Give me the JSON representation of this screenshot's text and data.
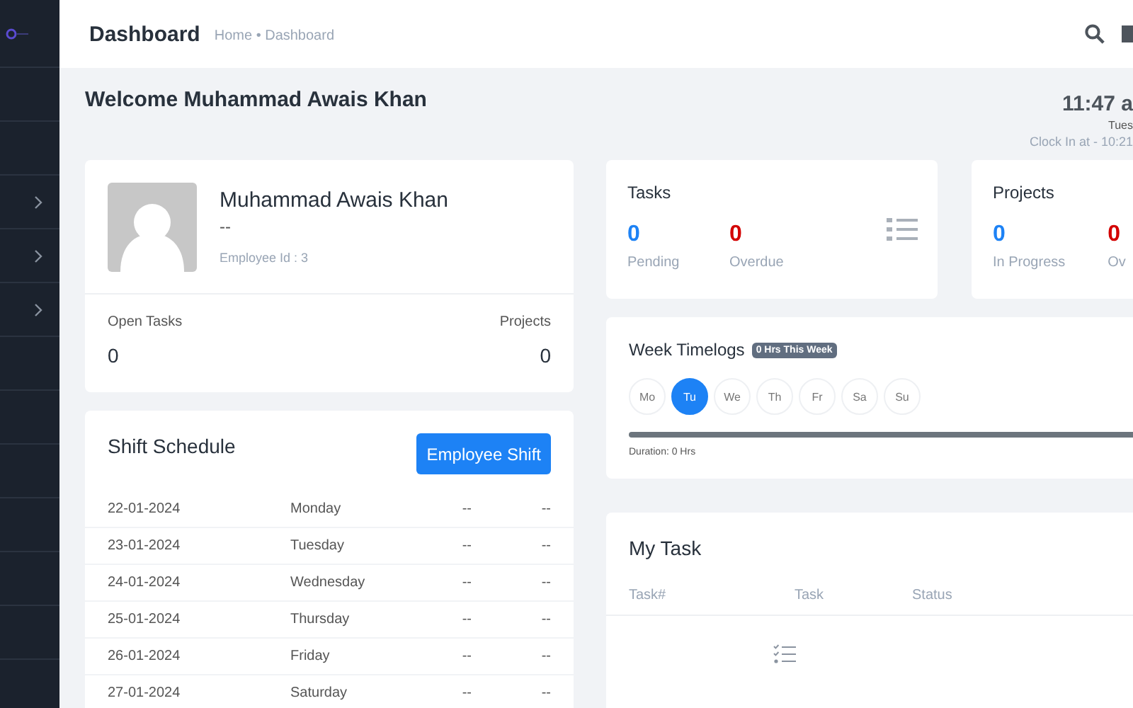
{
  "header": {
    "title": "Dashboard",
    "breadcrumb": "Home • Dashboard"
  },
  "sidebar": {
    "items": [
      {
        "kind": "plain"
      },
      {
        "kind": "plain"
      },
      {
        "kind": "group"
      },
      {
        "kind": "group"
      },
      {
        "kind": "group"
      },
      {
        "kind": "plain"
      },
      {
        "kind": "plain"
      },
      {
        "kind": "plain"
      },
      {
        "kind": "plain"
      },
      {
        "kind": "plain"
      },
      {
        "kind": "plain"
      }
    ]
  },
  "welcome": "Welcome Muhammad Awais Khan",
  "clock": {
    "time": "11:47 a",
    "date": "Tues",
    "clock_in": "Clock In at - 10:21"
  },
  "profile": {
    "name": "Muhammad Awais Khan",
    "designation": "--",
    "employee_id": "Employee Id : 3",
    "stats": [
      {
        "label": "Open Tasks",
        "value": "0"
      },
      {
        "label": "Projects",
        "value": "0"
      }
    ]
  },
  "tasks_card": {
    "title": "Tasks",
    "stats": [
      {
        "value": "0",
        "label": "Pending",
        "color": "#1d82f5"
      },
      {
        "value": "0",
        "label": "Overdue",
        "color": "#d30000"
      }
    ]
  },
  "projects_card": {
    "title": "Projects",
    "stats": [
      {
        "value": "0",
        "label": "In Progress",
        "color": "#1d82f5"
      },
      {
        "value": "0",
        "label": "Ov",
        "color": "#d30000"
      }
    ]
  },
  "shift_schedule": {
    "title": "Shift Schedule",
    "button": "Employee Shift",
    "rows": [
      {
        "date": "22-01-2024",
        "day": "Monday",
        "start": "--",
        "end": "--"
      },
      {
        "date": "23-01-2024",
        "day": "Tuesday",
        "start": "--",
        "end": "--"
      },
      {
        "date": "24-01-2024",
        "day": "Wednesday",
        "start": "--",
        "end": "--"
      },
      {
        "date": "25-01-2024",
        "day": "Thursday",
        "start": "--",
        "end": "--"
      },
      {
        "date": "26-01-2024",
        "day": "Friday",
        "start": "--",
        "end": "--"
      },
      {
        "date": "27-01-2024",
        "day": "Saturday",
        "start": "--",
        "end": "--"
      }
    ]
  },
  "week_timelogs": {
    "title": "Week Timelogs",
    "badge": "0 Hrs This Week",
    "days": [
      {
        "label": "Mo",
        "selected": false
      },
      {
        "label": "Tu",
        "selected": true
      },
      {
        "label": "We",
        "selected": false
      },
      {
        "label": "Th",
        "selected": false
      },
      {
        "label": "Fr",
        "selected": false
      },
      {
        "label": "Sa",
        "selected": false
      },
      {
        "label": "Su",
        "selected": false
      }
    ],
    "duration": "Duration: 0 Hrs"
  },
  "my_task": {
    "title": "My Task",
    "columns": [
      "Task#",
      "Task",
      "Status"
    ]
  }
}
